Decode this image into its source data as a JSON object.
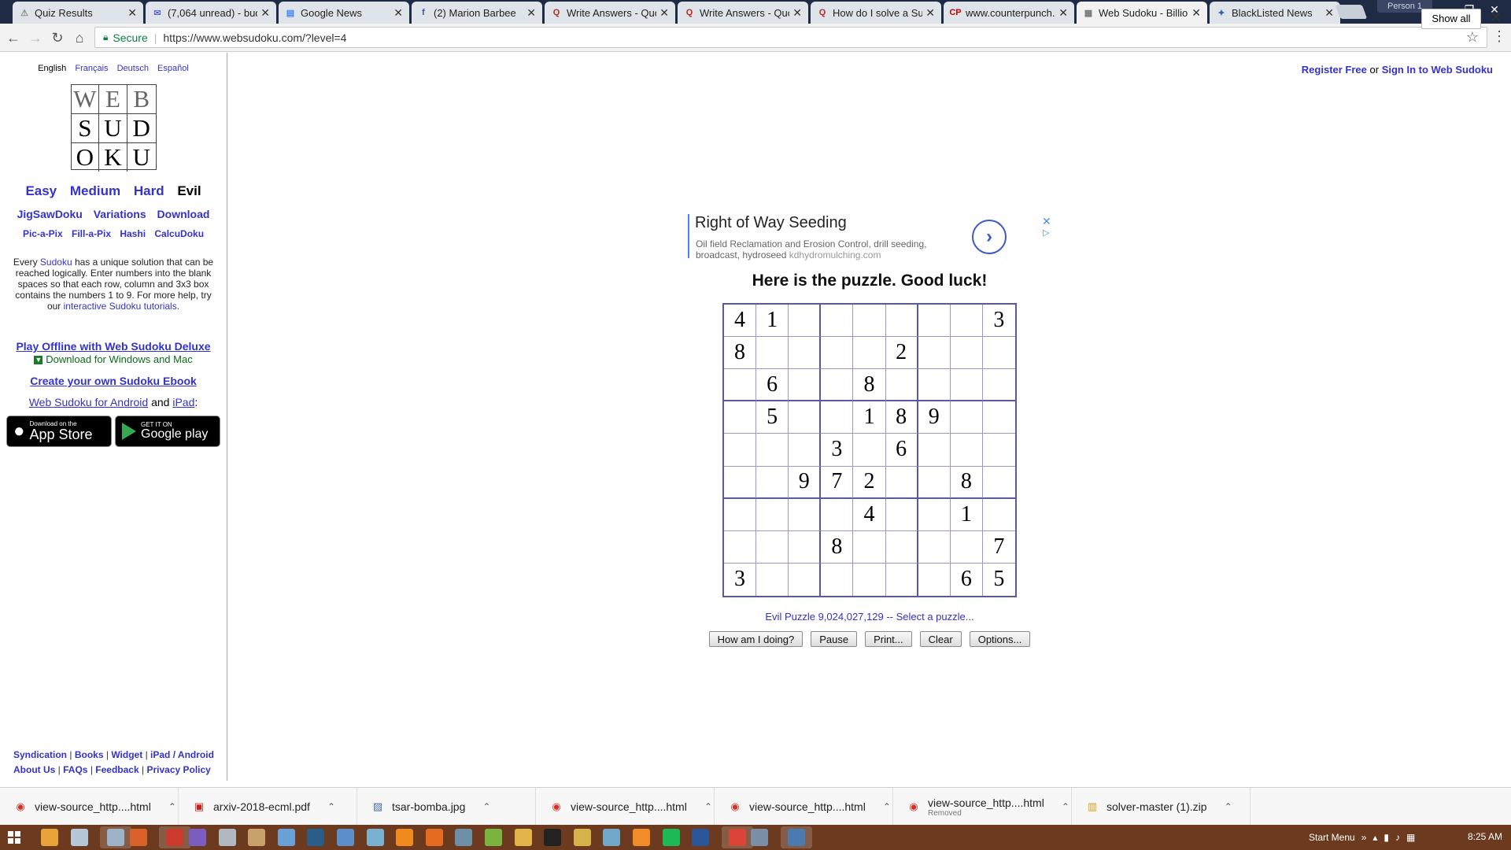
{
  "browser": {
    "tabs": [
      {
        "title": "Quiz Results",
        "icon": "warning-icon",
        "active": false
      },
      {
        "title": "(7,064 unread) - bud",
        "icon": "mail-icon",
        "active": false
      },
      {
        "title": "Google News",
        "icon": "news-icon",
        "active": false
      },
      {
        "title": "(2) Marion Barbee",
        "icon": "facebook-icon",
        "active": false
      },
      {
        "title": "Write Answers - Quo",
        "icon": "quora-icon",
        "active": false
      },
      {
        "title": "Write Answers - Quo",
        "icon": "quora-icon",
        "active": false
      },
      {
        "title": "How do I solve a Su",
        "icon": "quora-icon",
        "active": false
      },
      {
        "title": "www.counterpunch.o",
        "icon": "cp-icon",
        "active": false
      },
      {
        "title": "Web Sudoku - Billio",
        "icon": "grid-icon",
        "active": true
      },
      {
        "title": "BlackListed News",
        "icon": "blacklisted-icon",
        "active": false
      }
    ],
    "tab_close": "✕",
    "profile": "Person 1",
    "secure_label": "Secure",
    "url": "https://www.websudoku.com/?level=4"
  },
  "sidebar": {
    "languages": [
      "English",
      "Français",
      "Deutsch",
      "Español"
    ],
    "logo": [
      "W",
      "E",
      "B",
      "S",
      "U",
      "D",
      "O",
      "K",
      "U"
    ],
    "levels": [
      "Easy",
      "Medium",
      "Hard",
      "Evil"
    ],
    "links_row1": [
      "JigSawDoku",
      "Variations",
      "Download"
    ],
    "links_row2": [
      "Pic-a-Pix",
      "Fill-a-Pix",
      "Hashi",
      "CalcuDoku"
    ],
    "intro_pre": "Every ",
    "intro_link1": "Sudoku",
    "intro_mid": " has a unique solution that can be reached logically. Enter numbers into the blank spaces so that each row, column and 3x3 box contains the numbers 1 to 9. For more help, try our ",
    "intro_link2": "interactive Sudoku tutorials",
    "intro_end": ".",
    "offline_link": "Play Offline with Web Sudoku Deluxe",
    "download_line": "Download for Windows and Mac",
    "ebook_link": "Create your own Sudoku Ebook",
    "android_link": "Web Sudoku for Android",
    "and_text": " and ",
    "ipad_link": "iPad",
    "colon": ":",
    "appstore_small": "Download on the",
    "appstore_big": "App Store",
    "gplay_small": "GET IT ON",
    "gplay_big": "Google play",
    "footer_row1": [
      "Syndication",
      "Books",
      "Widget",
      "iPad / Android"
    ],
    "footer_row2": [
      "About Us",
      "FAQs",
      "Feedback",
      "Privacy Policy"
    ],
    "footer_sep": "|"
  },
  "auth": {
    "register": "Register Free",
    "or": " or ",
    "signin": "Sign In to Web Sudoku"
  },
  "ad": {
    "title": "Right of Way Seeding",
    "desc": "Oil field Reclamation and Erosion Control, drill seeding, broadcast, hydroseed ",
    "domain": "kdhydromulching.com",
    "arrow": "›",
    "close": "✕",
    "choice": "▷"
  },
  "puzzle": {
    "heading": "Here is the puzzle. Good luck!",
    "grid": [
      [
        "4",
        "1",
        "",
        "",
        "",
        "",
        "",
        "",
        "3"
      ],
      [
        "8",
        "",
        "",
        "",
        "",
        "2",
        "",
        "",
        ""
      ],
      [
        "",
        "6",
        "",
        "",
        "8",
        "",
        "",
        "",
        ""
      ],
      [
        "",
        "5",
        "",
        "",
        "1",
        "8",
        "9",
        "",
        ""
      ],
      [
        "",
        "",
        "",
        "3",
        "",
        "6",
        "",
        "",
        ""
      ],
      [
        "",
        "",
        "9",
        "7",
        "2",
        "",
        "",
        "8",
        ""
      ],
      [
        "",
        "",
        "",
        "",
        "4",
        "",
        "",
        "1",
        ""
      ],
      [
        "",
        "",
        "",
        "8",
        "",
        "",
        "",
        "",
        "7"
      ],
      [
        "3",
        "",
        "",
        "",
        "",
        "",
        "",
        "6",
        "5"
      ]
    ],
    "info": "Evil Puzzle 9,024,027,129 -- Select a puzzle...",
    "buttons": [
      "How am I doing?",
      "Pause",
      "Print...",
      "Clear",
      "Options..."
    ]
  },
  "downloads": {
    "items": [
      {
        "name": "view-source_http....html",
        "sub": "",
        "icon": "chrome-icon"
      },
      {
        "name": "arxiv-2018-ecml.pdf",
        "sub": "",
        "icon": "pdf-icon"
      },
      {
        "name": "tsar-bomba.jpg",
        "sub": "",
        "icon": "image-icon"
      },
      {
        "name": "view-source_http....html",
        "sub": "",
        "icon": "chrome-icon"
      },
      {
        "name": "view-source_http....html",
        "sub": "",
        "icon": "chrome-icon"
      },
      {
        "name": "view-source_http....html",
        "sub": "Removed",
        "icon": "chrome-icon"
      },
      {
        "name": "solver-master (1).zip",
        "sub": "",
        "icon": "zip-icon"
      }
    ],
    "show_all": "Show all",
    "close": "✕"
  },
  "taskbar": {
    "apps": [
      "chrome",
      "notepad",
      "files",
      "paint",
      "tools",
      "vscode",
      "folder",
      "mail",
      "explorer",
      "steam",
      "settings",
      "network",
      "vlc",
      "firefox",
      "remote",
      "git",
      "folder2",
      "cmd",
      "notes",
      "trash",
      "sublime",
      "spotify",
      "word",
      "chrome2",
      "search",
      "window"
    ],
    "start_menu": "Start Menu",
    "tray_chevron": "»",
    "clock": "8:25 AM"
  },
  "colors": {
    "link": "#3333cc",
    "grid_border": "#5a5aa0",
    "tabstrip": "#1f2a44",
    "taskbar": "#6b3a1f"
  }
}
